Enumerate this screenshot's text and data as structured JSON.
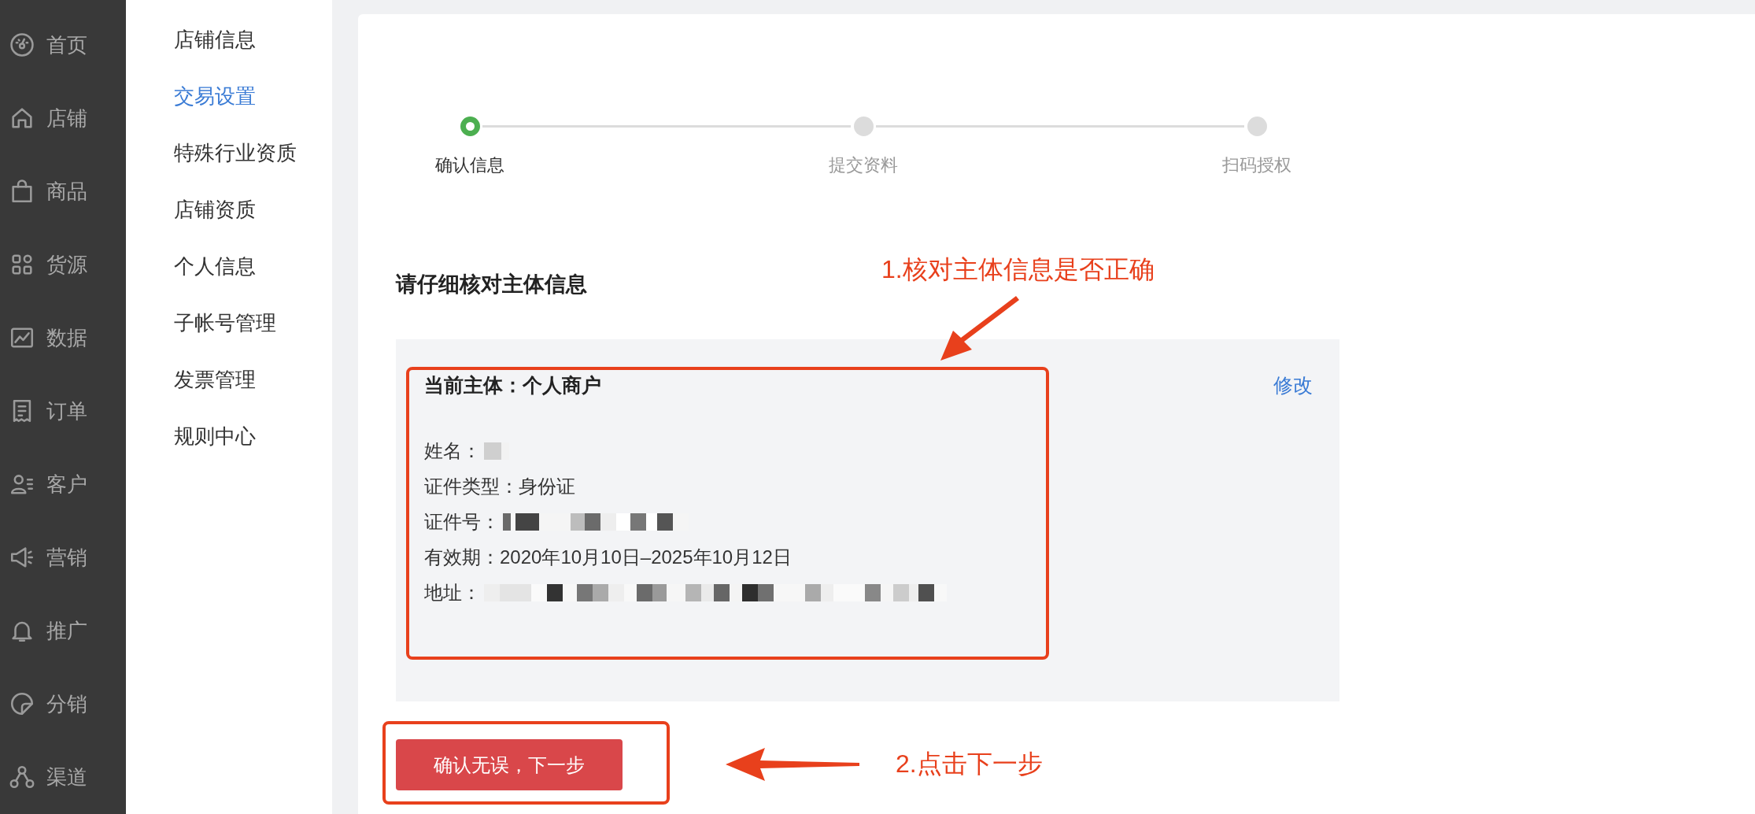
{
  "nav": [
    {
      "label": "首页"
    },
    {
      "label": "店铺"
    },
    {
      "label": "商品"
    },
    {
      "label": "货源"
    },
    {
      "label": "数据"
    },
    {
      "label": "订单"
    },
    {
      "label": "客户"
    },
    {
      "label": "营销"
    },
    {
      "label": "推广"
    },
    {
      "label": "分销"
    },
    {
      "label": "渠道"
    }
  ],
  "submenu": [
    {
      "label": "店铺信息",
      "selected": false
    },
    {
      "label": "交易设置",
      "selected": true
    },
    {
      "label": "特殊行业资质",
      "selected": false
    },
    {
      "label": "店铺资质",
      "selected": false
    },
    {
      "label": "个人信息",
      "selected": false
    },
    {
      "label": "子帐号管理",
      "selected": false
    },
    {
      "label": "发票管理",
      "selected": false
    },
    {
      "label": "规则中心",
      "selected": false
    }
  ],
  "steps": [
    {
      "label": "确认信息",
      "selected": true
    },
    {
      "label": "提交资料",
      "selected": false
    },
    {
      "label": "扫码授权",
      "selected": false
    }
  ],
  "heading": "请仔细核对主体信息",
  "info": {
    "subject": "当前主体：个人商户",
    "edit_link": "修改",
    "fields": [
      {
        "label": "姓名：",
        "masked": true
      },
      {
        "label": "证件类型：",
        "value": "身份证",
        "masked": false
      },
      {
        "label": "证件号：",
        "masked": true
      },
      {
        "label": "有效期：",
        "value": "2020年10月10日–2025年10月12日",
        "masked": false
      },
      {
        "label": "地址：",
        "masked": true
      }
    ]
  },
  "next_button": "确认无误，下一步",
  "annotations": [
    {
      "text": "1.核对主体信息是否正确"
    },
    {
      "text": "2.点击下一步"
    }
  ]
}
